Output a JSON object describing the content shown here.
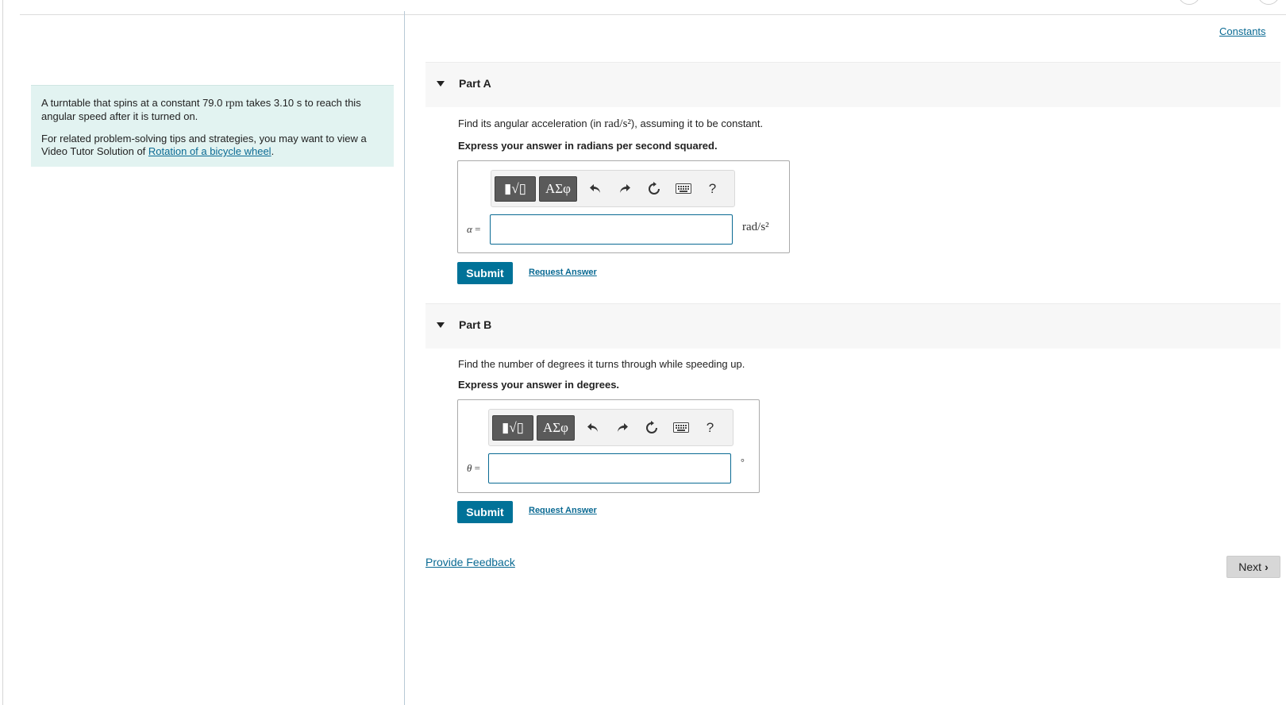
{
  "problem": {
    "text_before": "A turntable that spins at a constant 79.0 ",
    "rpm": "rpm",
    "text_after": " takes 3.10 s to reach this angular speed after it is turned on.",
    "tip_text": "For related problem-solving tips and strategies, you may want to view a Video Tutor Solution of ",
    "tip_link": "Rotation of a bicycle wheel",
    "tip_end": "."
  },
  "constants_link": "Constants",
  "toolbar": {
    "template_label": "▮√▯",
    "greek_label": "ΑΣφ",
    "help_label": "?"
  },
  "partA": {
    "title": "Part A",
    "question_before": "Find its angular acceleration (in ",
    "question_unit": "rad/s²",
    "question_after": "), assuming it to be constant.",
    "instruction": "Express your answer in radians per second squared.",
    "variable": "α",
    "equals": "=",
    "input_value": "",
    "unit": "rad/s²",
    "submit_label": "Submit",
    "request_label": "Request Answer"
  },
  "partB": {
    "title": "Part B",
    "question": "Find the number of degrees it turns through while speeding up.",
    "instruction": "Express your answer in degrees.",
    "variable": "θ",
    "equals": "=",
    "input_value": "",
    "unit": "°",
    "submit_label": "Submit",
    "request_label": "Request Answer"
  },
  "feedback_link": "Provide Feedback",
  "next_label": "Next"
}
